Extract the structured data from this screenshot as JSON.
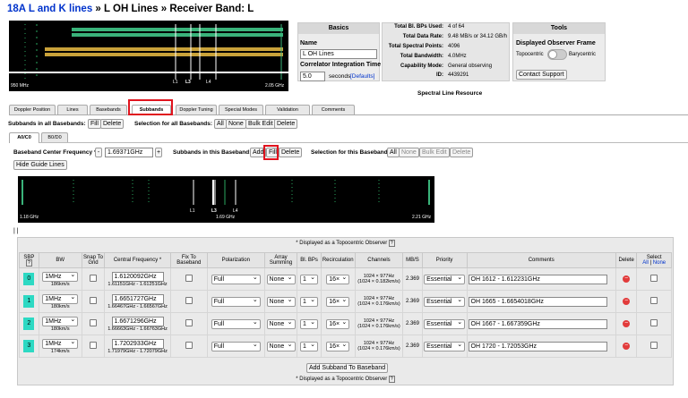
{
  "header": {
    "link": "18A L and K lines",
    "sep1": " » ",
    "part2": "L OH Lines",
    "sep2": " » ",
    "part3": "Receiver Band: L"
  },
  "top_plot": {
    "left_label": "950 MHz",
    "right_label": "2.05 GHz",
    "line_labels": [
      "L1",
      "L3",
      "L4"
    ]
  },
  "basics": {
    "title": "Basics",
    "name_label": "Name",
    "name_value": "L OH Lines",
    "corr_label": "Correlator Integration Time",
    "corr_value": "5.0",
    "corr_unit": "seconds",
    "defaults_link": "[Defaults]"
  },
  "stats": [
    {
      "label": "Total Bl. BPs Used:",
      "value": "4 of 64"
    },
    {
      "label": "Total Data Rate:",
      "value": "9.48 MB/s or 34.12 GB/h"
    },
    {
      "label": "Total Spectral Points:",
      "value": "4096"
    },
    {
      "label": "Total Bandwidth:",
      "value": "4.0MHz"
    },
    {
      "label": "Capability Mode:",
      "value": "General observing"
    },
    {
      "label": "ID:",
      "value": "4439291"
    }
  ],
  "tools": {
    "title": "Tools",
    "frame_label": "Displayed Observer Frame",
    "topocentric": "Topocentric",
    "barycentric": "Barycentric",
    "support": "Contact Support"
  },
  "spectral_line_resource": "Spectral Line Resource",
  "tabs": [
    "Doppler Position",
    "Lines",
    "Basebands",
    "Subbands",
    "Doppler Tuning",
    "Special Modes",
    "Validation",
    "Comments"
  ],
  "subbands_all": {
    "label": "Subbands in all Basebands:",
    "fill": "Fill",
    "delete": "Delete",
    "sel_label": "Selection for all Basebands:",
    "all": "All",
    "none": "None",
    "bulk_edit": "Bulk Edit",
    "sel_delete": "Delete"
  },
  "baseband_tabs": [
    "A0/C0",
    "B0/D0"
  ],
  "baseband": {
    "center_label": "Baseband Center Frequency *:",
    "minus": "-",
    "center_value": "1.69371GHz",
    "plus": "+",
    "sub_label": "Subbands in this Baseband:",
    "add": "Add",
    "fill": "Fill",
    "delete": "Delete",
    "sel_label": "Selection for this Baseband:",
    "all": "All",
    "none": "None",
    "bulk_edit": "Bulk Edit",
    "sel_delete": "Delete",
    "hide_guide": "Hide Guide Lines"
  },
  "bb_plot": {
    "left_label": "1.18 GHz",
    "center_label": "1.69 GHz",
    "right_label": "2.21 GHz",
    "line_labels": [
      "L1",
      "L3",
      "L4"
    ]
  },
  "bars": "| |",
  "table": {
    "note": "* Displayed as a Topocentric Observer",
    "help": "?",
    "headers": [
      "SBP",
      "BW",
      "Snap To Grid",
      "Central Frequency *",
      "Fix To Baseband",
      "Polarization",
      "Array Summing",
      "Bl. BPs",
      "Recirculation",
      "Channels",
      "MB/S",
      "Priority",
      "Comments",
      "Delete",
      "Select"
    ],
    "select_all": "All",
    "select_sep": " | ",
    "select_none": "None",
    "rows": [
      {
        "sbp": "0",
        "bw": "1MHz",
        "bw_sub": "186km/s",
        "freq": "1.6120092GHz",
        "freq_sub": "1.61151GHz - 1.61251GHz",
        "pol": "Full",
        "sum": "None",
        "bps": "1",
        "recirc": "16×",
        "ch": "1024 × 977Hz",
        "ch_sub": "(1024 × 0.182km/s)",
        "mbs": "2.369",
        "prio": "Essential",
        "comment": "OH 1612 - 1.612231GHz"
      },
      {
        "sbp": "1",
        "bw": "1MHz",
        "bw_sub": "180km/s",
        "freq": "1.6651727GHz",
        "freq_sub": "1.66467GHz - 1.66567GHz",
        "pol": "Full",
        "sum": "None",
        "bps": "1",
        "recirc": "16×",
        "ch": "1024 × 977Hz",
        "ch_sub": "(1024 × 0.176km/s)",
        "mbs": "2.369",
        "prio": "Essential",
        "comment": "OH 1665 - 1.6654018GHz"
      },
      {
        "sbp": "2",
        "bw": "1MHz",
        "bw_sub": "180km/s",
        "freq": "1.6671296GHz",
        "freq_sub": "1.66663GHz - 1.66763GHz",
        "pol": "Full",
        "sum": "None",
        "bps": "1",
        "recirc": "16×",
        "ch": "1024 × 977Hz",
        "ch_sub": "(1024 × 0.176km/s)",
        "mbs": "2.369",
        "prio": "Essential",
        "comment": "OH 1667 - 1.667359GHz"
      },
      {
        "sbp": "3",
        "bw": "1MHz",
        "bw_sub": "174km/s",
        "freq": "1.7202933GHz",
        "freq_sub": "1.71979GHz - 1.72079GHz",
        "pol": "Full",
        "sum": "None",
        "bps": "1",
        "recirc": "16×",
        "ch": "1024 × 977Hz",
        "ch_sub": "(1024 × 0.176km/s)",
        "mbs": "2.369",
        "prio": "Essential",
        "comment": "OH 1720 - 1.72053GHz"
      }
    ],
    "add_button": "Add Subband To Baseband"
  },
  "colors": {
    "accent_highlight": "#e0141e",
    "sbp_teal": "#2dd9c3",
    "band_green": "#3ab37a",
    "band_gold": "#c9a23a",
    "link_blue": "#0033cc"
  }
}
